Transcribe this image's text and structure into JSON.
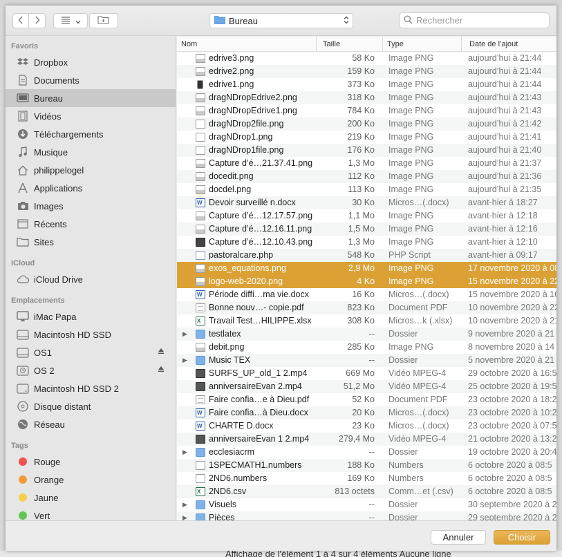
{
  "background": {
    "bottom_text": "Affichage de l'élément 1 à 4 sur 4 éléments   Aucune ligne"
  },
  "toolbar": {
    "location": "Bureau",
    "search_placeholder": "Rechercher"
  },
  "sidebar": {
    "favorites_title": "Favoris",
    "favorites": [
      {
        "label": "Dropbox",
        "icon": "dropbox-icon"
      },
      {
        "label": "Documents",
        "icon": "documents-icon"
      },
      {
        "label": "Bureau",
        "icon": "desktop-icon",
        "selected": true
      },
      {
        "label": "Vidéos",
        "icon": "film-icon"
      },
      {
        "label": "Téléchargements",
        "icon": "download-icon"
      },
      {
        "label": "Musique",
        "icon": "music-note-icon"
      },
      {
        "label": "philippelogel",
        "icon": "home-icon"
      },
      {
        "label": "Applications",
        "icon": "applications-icon"
      },
      {
        "label": "Images",
        "icon": "camera-icon"
      },
      {
        "label": "Récents",
        "icon": "clock-icon"
      },
      {
        "label": "Sites",
        "icon": "folder-icon"
      }
    ],
    "icloud_title": "iCloud",
    "icloud": [
      {
        "label": "iCloud Drive",
        "icon": "cloud-icon"
      }
    ],
    "locations_title": "Emplacements",
    "locations": [
      {
        "label": "iMac Papa",
        "icon": "imac-icon",
        "eject": false
      },
      {
        "label": "Macintosh HD SSD",
        "icon": "disk-icon",
        "eject": false
      },
      {
        "label": "OS1",
        "icon": "disk-icon",
        "eject": true
      },
      {
        "label": "OS 2",
        "icon": "timemachine-disk-icon",
        "eject": true
      },
      {
        "label": "Macintosh HD SSD 2",
        "icon": "external-disk-icon",
        "eject": false
      },
      {
        "label": "Disque distant",
        "icon": "optical-disc-icon",
        "eject": false
      },
      {
        "label": "Réseau",
        "icon": "network-globe-icon",
        "eject": false
      }
    ],
    "tags_title": "Tags",
    "tags": [
      {
        "label": "Rouge",
        "color": "#f0524f"
      },
      {
        "label": "Orange",
        "color": "#f59a3b"
      },
      {
        "label": "Jaune",
        "color": "#f6d04d"
      },
      {
        "label": "Vert",
        "color": "#62c554"
      }
    ]
  },
  "columns": {
    "name": "Nom",
    "size": "Taille",
    "kind": "Type",
    "date": "Date de l’ajout"
  },
  "files": [
    {
      "name": "edrive3.png",
      "size": "58 Ko",
      "kind": "Image PNG",
      "date": "aujourd’hui à 21:44",
      "icon": "png"
    },
    {
      "name": "edrive2.png",
      "size": "159 Ko",
      "kind": "Image PNG",
      "date": "aujourd’hui à 21:44",
      "icon": "png"
    },
    {
      "name": "edrive1.png",
      "size": "373 Ko",
      "kind": "Image PNG",
      "date": "aujourd’hui à 21:44",
      "icon": "phone"
    },
    {
      "name": "dragNDropEdrive2.png",
      "size": "318 Ko",
      "kind": "Image PNG",
      "date": "aujourd’hui à 21:43",
      "icon": "png"
    },
    {
      "name": "dragNDropEdrive1.png",
      "size": "784 Ko",
      "kind": "Image PNG",
      "date": "aujourd’hui à 21:43",
      "icon": "png"
    },
    {
      "name": "dragNDrop2file.png",
      "size": "200 Ko",
      "kind": "Image PNG",
      "date": "aujourd’hui à 21:42",
      "icon": "doc"
    },
    {
      "name": "dragNDrop1.png",
      "size": "219 Ko",
      "kind": "Image PNG",
      "date": "aujourd’hui à 21:41",
      "icon": "doc"
    },
    {
      "name": "dragNDrop1file.png",
      "size": "176 Ko",
      "kind": "Image PNG",
      "date": "aujourd’hui à 21:40",
      "icon": "doc"
    },
    {
      "name": "Capture d’é…21.37.41.png",
      "size": "1,3 Mo",
      "kind": "Image PNG",
      "date": "aujourd’hui à 21:37",
      "icon": "png"
    },
    {
      "name": "docedit.png",
      "size": "112 Ko",
      "kind": "Image PNG",
      "date": "aujourd’hui à 21:36",
      "icon": "png"
    },
    {
      "name": "docdel.png",
      "size": "113 Ko",
      "kind": "Image PNG",
      "date": "aujourd’hui à 21:35",
      "icon": "png"
    },
    {
      "name": "Devoir surveillé n.docx",
      "size": "30 Ko",
      "kind": "Micros…(.docx)",
      "date": "avant-hier à 18:27",
      "icon": "word"
    },
    {
      "name": "Capture d’é…12.17.57.png",
      "size": "1,1 Mo",
      "kind": "Image PNG",
      "date": "avant-hier à 12:18",
      "icon": "png"
    },
    {
      "name": "Capture d’é…12.16.11.png",
      "size": "1,5 Mo",
      "kind": "Image PNG",
      "date": "avant-hier à 12:16",
      "icon": "png"
    },
    {
      "name": "Capture d’é…12.10.43.png",
      "size": "1,3 Mo",
      "kind": "Image PNG",
      "date": "avant-hier à 12:10",
      "icon": "dark"
    },
    {
      "name": "pastoralcare.php",
      "size": "548 Ko",
      "kind": "PHP Script",
      "date": "avant-hier à 09:17",
      "icon": "php"
    },
    {
      "name": "exos_equations.png",
      "size": "2,9 Mo",
      "kind": "Image PNG",
      "date": "17 novembre 2020 à 08",
      "icon": "png",
      "selected": true
    },
    {
      "name": "logo-web-2020.png",
      "size": "4 Ko",
      "kind": "Image PNG",
      "date": "15 novembre 2020 à 22",
      "icon": "png",
      "selected": true
    },
    {
      "name": "Période diffi…ma vie.docx",
      "size": "16 Ko",
      "kind": "Micros…(.docx)",
      "date": "15 novembre 2020 à 16",
      "icon": "word"
    },
    {
      "name": "Bonne nouv…- copie.pdf",
      "size": "823 Ko",
      "kind": "Document PDF",
      "date": "10 novembre 2020 à 22",
      "icon": "pdf"
    },
    {
      "name": "Travail Test…HILIPPE.xlsx",
      "size": "308 Ko",
      "kind": "Micros…k (.xlsx)",
      "date": "10 novembre 2020 à 21",
      "icon": "xls"
    },
    {
      "name": "testlatex",
      "size": "--",
      "kind": "Dossier",
      "date": "9 novembre 2020 à 21",
      "icon": "folder",
      "folder": true
    },
    {
      "name": "debit.png",
      "size": "285 Ko",
      "kind": "Image PNG",
      "date": "8 novembre 2020 à 14",
      "icon": "png"
    },
    {
      "name": "Music TEX",
      "size": "--",
      "kind": "Dossier",
      "date": "5 novembre 2020 à 21",
      "icon": "folder",
      "folder": true
    },
    {
      "name": "SURFS_UP_old_1 2.mp4",
      "size": "669 Mo",
      "kind": "Vidéo MPEG-4",
      "date": "29 octobre 2020 à 16:5",
      "icon": "video"
    },
    {
      "name": "anniversaireEvan 2.mp4",
      "size": "51,2 Mo",
      "kind": "Vidéo MPEG-4",
      "date": "25 octobre 2020 à 19:5",
      "icon": "video"
    },
    {
      "name": "Faire confia…e à Dieu.pdf",
      "size": "52 Ko",
      "kind": "Document PDF",
      "date": "23 octobre 2020 à 18:2",
      "icon": "pdf"
    },
    {
      "name": "Faire confia…à Dieu.docx",
      "size": "20 Ko",
      "kind": "Micros…(.docx)",
      "date": "23 octobre 2020 à 10:2",
      "icon": "word"
    },
    {
      "name": "CHARTE D.docx",
      "size": "23 Ko",
      "kind": "Micros…(.docx)",
      "date": "23 octobre 2020 à 07:5",
      "icon": "word"
    },
    {
      "name": "anniversaireEvan 1 2.mp4",
      "size": "279,4 Mo",
      "kind": "Vidéo MPEG-4",
      "date": "21 octobre 2020 à 13:2",
      "icon": "video"
    },
    {
      "name": "ecclesiacrm",
      "size": "--",
      "kind": "Dossier",
      "date": "19 octobre 2020 à 20:4",
      "icon": "folder",
      "folder": true
    },
    {
      "name": "1SPECMATH1.numbers",
      "size": "188 Ko",
      "kind": "Numbers",
      "date": "6 octobre 2020 à 08:5",
      "icon": "doc"
    },
    {
      "name": "2ND6.numbers",
      "size": "169 Ko",
      "kind": "Numbers",
      "date": "6 octobre 2020 à 08:5",
      "icon": "doc"
    },
    {
      "name": "2ND6.csv",
      "size": "813 octets",
      "kind": "Comm…et (.csv)",
      "date": "6 octobre 2020 à 08:5",
      "icon": "xls"
    },
    {
      "name": "Visuels",
      "size": "--",
      "kind": "Dossier",
      "date": "30 septembre 2020 à 2",
      "icon": "folder",
      "folder": true
    },
    {
      "name": "Pièces",
      "size": "--",
      "kind": "Dossier",
      "date": "29 septembre 2020 à 2",
      "icon": "folder",
      "folder": true
    }
  ],
  "buttons": {
    "cancel": "Annuler",
    "choose": "Choisir"
  }
}
